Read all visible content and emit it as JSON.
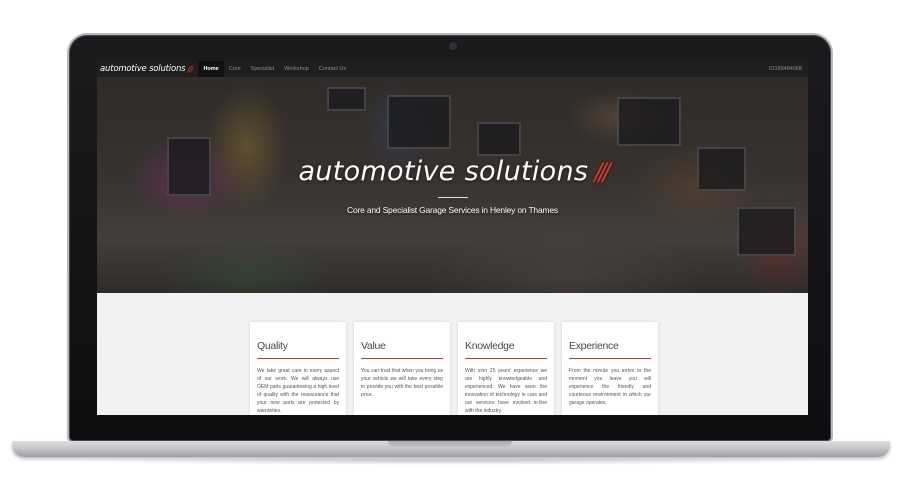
{
  "nav": {
    "brand": "automotive solutions",
    "brand_mark": "///",
    "items": [
      {
        "label": "Home",
        "active": true
      },
      {
        "label": "Core",
        "active": false
      },
      {
        "label": "Specialist",
        "active": false
      },
      {
        "label": "Workshop",
        "active": false
      },
      {
        "label": "Contact Us",
        "active": false
      }
    ],
    "phone": "01189484068"
  },
  "hero": {
    "title": "automotive solutions",
    "title_mark": "///",
    "subtitle": "Core and Specialist Garage Services in Henley on Thames"
  },
  "cards": [
    {
      "title": "Quality",
      "text": "We take great care in every aspect of our work. We will always use OEM parts guaranteeing a high level of quality with the reassurance that your new parts are protected by warranties."
    },
    {
      "title": "Value",
      "text": "You can trust that when you bring us your vehicle we will take every step to provide you with the best possible price."
    },
    {
      "title": "Knowledge",
      "text": "With over 25 years' experience we are highly knowledgeable and experienced. We have seen the innovation of technology in cars and our services have evolved in-line with the industry."
    },
    {
      "title": "Experience",
      "text": "From the minute you arrive to the moment you leave you will experience the friendly and courteous environment in which our garage operates."
    }
  ],
  "colors": {
    "accent": "#c0392b",
    "nav_bg": "#1e1e1f"
  }
}
